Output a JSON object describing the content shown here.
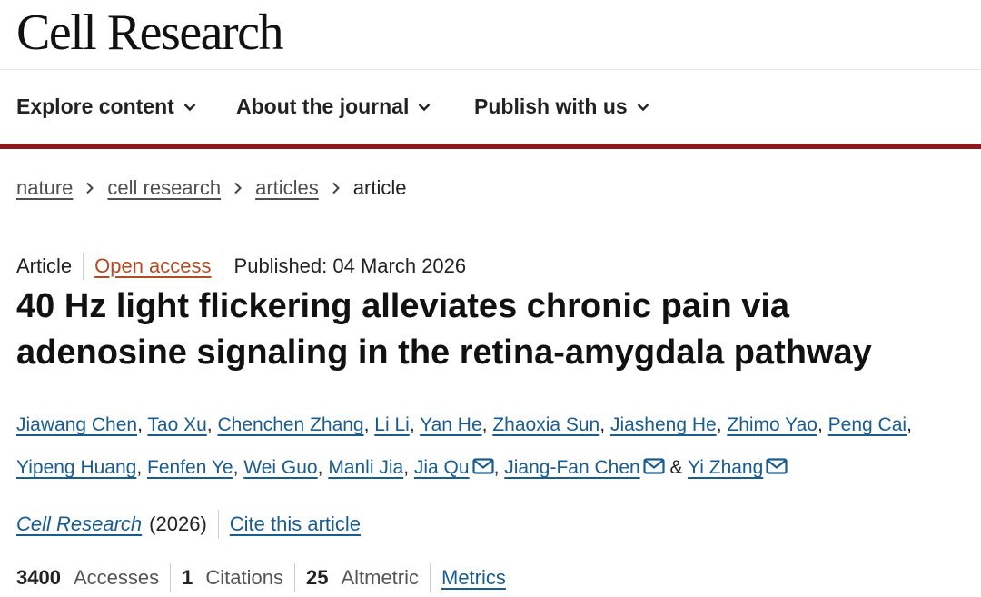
{
  "header": {
    "logo_text": "Cell Research"
  },
  "nav": {
    "items": [
      {
        "label": "Explore content"
      },
      {
        "label": "About the journal"
      },
      {
        "label": "Publish with us"
      }
    ]
  },
  "breadcrumb": {
    "items": [
      "nature",
      "cell research",
      "articles",
      "article"
    ]
  },
  "article": {
    "type": "Article",
    "access": "Open access",
    "published": "Published: 04 March 2026",
    "title_line1": "40 Hz light flickering alleviates chronic pain via",
    "title_line2": "adenosine signaling in the retina-amygdala pathway"
  },
  "authors": [
    "Jiawang Chen",
    "Tao Xu",
    "Chenchen Zhang",
    "Li Li",
    "Yan He",
    "Zhaoxia Sun",
    "Jiasheng He",
    "Zhimo Yao",
    "Peng Cai",
    "Yipeng Huang",
    "Fenfen Ye",
    "Wei Guo",
    "Manli Jia",
    "Jia Qu",
    "Jiang-Fan Chen",
    "Yi Zhang"
  ],
  "author_sep": {
    "comma": ",",
    "and": "&"
  },
  "journal": {
    "name": "Cell Research",
    "year": "(2026)",
    "cite_label": "Cite this article"
  },
  "metrics": {
    "accesses_value": "3400",
    "accesses_label": "Accesses",
    "citations_value": "1",
    "citations_label": "Citations",
    "altmetric_value": "25",
    "altmetric_label": "Altmetric",
    "metrics_link": "Metrics"
  },
  "colors": {
    "brand_bar": "#8a1a1d",
    "link": "#1b5c8f",
    "open_access": "#b24b28"
  },
  "icons": {
    "nav_chevron": "chevron-down-icon",
    "breadcrumb_sep": "chevron-right-icon",
    "corresponding": "mail-icon"
  }
}
